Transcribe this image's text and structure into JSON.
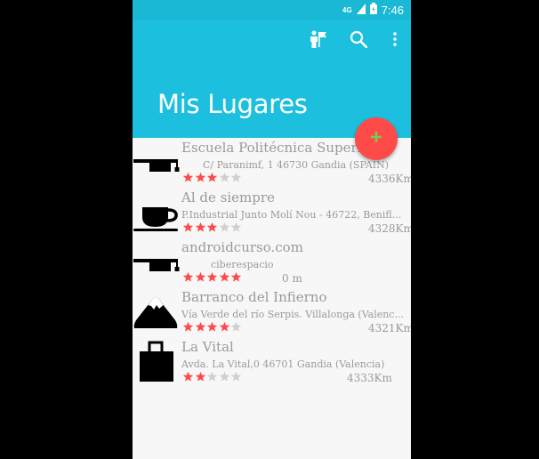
{
  "status_bar": {
    "network": "4G",
    "time": "7:46"
  },
  "app_bar": {
    "title": "Mis Lugares",
    "actions": [
      "map-icon",
      "search-icon",
      "more-vert-icon"
    ]
  },
  "fab": {
    "icon": "add-icon"
  },
  "colors": {
    "app_bar": "#1cc0de",
    "status_bar": "#1ab8d4",
    "fab": "#ff4a4a",
    "star_on": "#ff4a4a",
    "star_off": "#cfcfcf"
  },
  "places": [
    {
      "name": "Escuela Politécnica Superior de...",
      "address": "C/ Paranimf, 1 46730 Gandia (SPAIN)",
      "rating": 3,
      "distance": "4336Km",
      "icon": "graduation-cap-icon"
    },
    {
      "name": "Al de siempre",
      "address": "P.Industrial Junto Molí Nou - 46722, Benifl...",
      "rating": 3,
      "distance": "4328Km",
      "icon": "coffee-cup-icon"
    },
    {
      "name": "androidcurso.com",
      "address": "ciberespacio",
      "rating": 5,
      "distance": "0 m",
      "icon": "graduation-cap-icon"
    },
    {
      "name": "Barranco del Infierno",
      "address": "Vía Verde del río Serpis. Villalonga (Valenc...",
      "rating": 4,
      "distance": "4321Km",
      "icon": "mountain-icon"
    },
    {
      "name": "La Vital",
      "address": "Avda. La Vital,0 46701 Gandia (Valencia)",
      "rating": 2,
      "distance": "4333Km",
      "icon": "shopping-bag-icon"
    }
  ]
}
